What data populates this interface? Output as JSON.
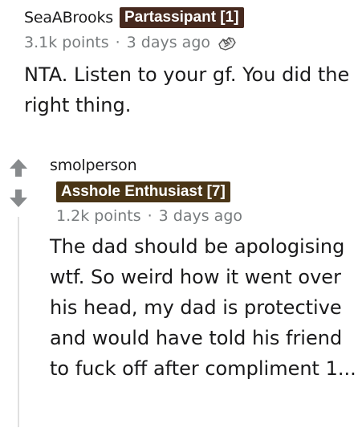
{
  "colors": {
    "flair_1_bg": "#46291e",
    "flair_2_bg": "#4a3516",
    "meta_text": "#787c7e",
    "body_text": "#1a1a1b",
    "thread_line": "#e0e0e0",
    "vote_arrow": "#878a8c"
  },
  "comments": [
    {
      "username": "SeaABrooks",
      "flair": "Partassipant [1]",
      "points": "3.1k points",
      "separator": "·",
      "time": "3 days ago",
      "award_icon": "award-hands-icon",
      "body": "NTA. Listen to your gf. You did the right thing."
    },
    {
      "username": "smolperson",
      "flair": "Asshole Enthusiast [7]",
      "points": "1.2k points",
      "separator": "·",
      "time": "3 days ago",
      "upvote_icon": "upvote-arrow-icon",
      "downvote_icon": "downvote-arrow-icon",
      "body": "The dad should be apologising wtf. So weird how it went over his head, my dad is protective and would have told his friend to fuck off after compliment 1..."
    }
  ]
}
